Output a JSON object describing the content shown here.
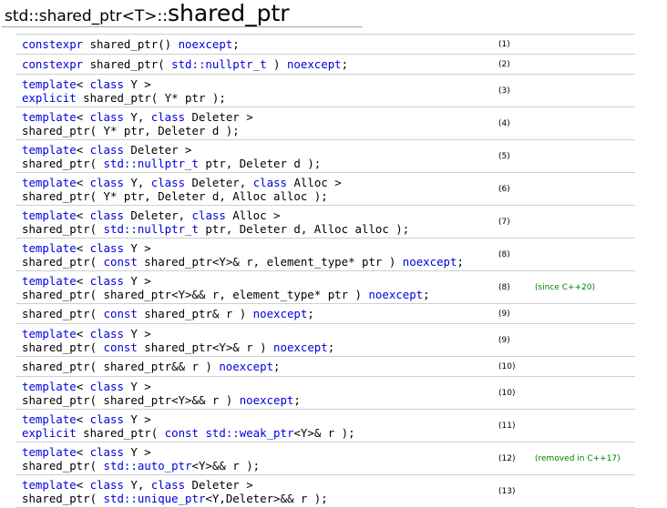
{
  "title": {
    "prefix": "std::shared_ptr<T>::",
    "name": "shared_ptr"
  },
  "rows": [
    {
      "lines": [
        [
          [
            "kw",
            "constexpr"
          ],
          [
            "t",
            " shared_ptr() "
          ],
          [
            "kw",
            "noexcept"
          ],
          [
            "t",
            ";"
          ]
        ]
      ],
      "num": "(1)",
      "note": ""
    },
    {
      "lines": [
        [
          [
            "kw",
            "constexpr"
          ],
          [
            "t",
            " shared_ptr( "
          ],
          [
            "kw",
            "std::nullptr_t"
          ],
          [
            "t",
            " ) "
          ],
          [
            "kw",
            "noexcept"
          ],
          [
            "t",
            ";"
          ]
        ]
      ],
      "num": "(2)",
      "note": ""
    },
    {
      "lines": [
        [
          [
            "kw",
            "template"
          ],
          [
            "t",
            "< "
          ],
          [
            "kw",
            "class"
          ],
          [
            "t",
            " Y >"
          ]
        ],
        [
          [
            "kw",
            "explicit"
          ],
          [
            "t",
            " shared_ptr( Y* ptr );"
          ]
        ]
      ],
      "num": "(3)",
      "note": ""
    },
    {
      "lines": [
        [
          [
            "kw",
            "template"
          ],
          [
            "t",
            "< "
          ],
          [
            "kw",
            "class"
          ],
          [
            "t",
            " Y, "
          ],
          [
            "kw",
            "class"
          ],
          [
            "t",
            " Deleter >"
          ]
        ],
        [
          [
            "t",
            "shared_ptr( Y* ptr, Deleter d );"
          ]
        ]
      ],
      "num": "(4)",
      "note": ""
    },
    {
      "lines": [
        [
          [
            "kw",
            "template"
          ],
          [
            "t",
            "< "
          ],
          [
            "kw",
            "class"
          ],
          [
            "t",
            " Deleter >"
          ]
        ],
        [
          [
            "t",
            "shared_ptr( "
          ],
          [
            "kw",
            "std::nullptr_t"
          ],
          [
            "t",
            " ptr, Deleter d );"
          ]
        ]
      ],
      "num": "(5)",
      "note": ""
    },
    {
      "lines": [
        [
          [
            "kw",
            "template"
          ],
          [
            "t",
            "< "
          ],
          [
            "kw",
            "class"
          ],
          [
            "t",
            " Y, "
          ],
          [
            "kw",
            "class"
          ],
          [
            "t",
            " Deleter, "
          ],
          [
            "kw",
            "class"
          ],
          [
            "t",
            " Alloc >"
          ]
        ],
        [
          [
            "t",
            "shared_ptr( Y* ptr, Deleter d, Alloc alloc );"
          ]
        ]
      ],
      "num": "(6)",
      "note": ""
    },
    {
      "lines": [
        [
          [
            "kw",
            "template"
          ],
          [
            "t",
            "< "
          ],
          [
            "kw",
            "class"
          ],
          [
            "t",
            " Deleter, "
          ],
          [
            "kw",
            "class"
          ],
          [
            "t",
            " Alloc >"
          ]
        ],
        [
          [
            "t",
            "shared_ptr( "
          ],
          [
            "kw",
            "std::nullptr_t"
          ],
          [
            "t",
            " ptr, Deleter d, Alloc alloc );"
          ]
        ]
      ],
      "num": "(7)",
      "note": ""
    },
    {
      "lines": [
        [
          [
            "kw",
            "template"
          ],
          [
            "t",
            "< "
          ],
          [
            "kw",
            "class"
          ],
          [
            "t",
            " Y >"
          ]
        ],
        [
          [
            "t",
            "shared_ptr( "
          ],
          [
            "kw",
            "const"
          ],
          [
            "t",
            " shared_ptr<Y>& r, element_type* ptr ) "
          ],
          [
            "kw",
            "noexcept"
          ],
          [
            "t",
            ";"
          ]
        ]
      ],
      "num": "(8)",
      "note": ""
    },
    {
      "lines": [
        [
          [
            "kw",
            "template"
          ],
          [
            "t",
            "< "
          ],
          [
            "kw",
            "class"
          ],
          [
            "t",
            " Y >"
          ]
        ],
        [
          [
            "t",
            "shared_ptr( shared_ptr<Y>&& r, element_type* ptr ) "
          ],
          [
            "kw",
            "noexcept"
          ],
          [
            "t",
            ";"
          ]
        ]
      ],
      "num": "(8)",
      "note": "(since C++20)"
    },
    {
      "lines": [
        [
          [
            "t",
            "shared_ptr( "
          ],
          [
            "kw",
            "const"
          ],
          [
            "t",
            " shared_ptr& r ) "
          ],
          [
            "kw",
            "noexcept"
          ],
          [
            "t",
            ";"
          ]
        ]
      ],
      "num": "(9)",
      "note": ""
    },
    {
      "lines": [
        [
          [
            "kw",
            "template"
          ],
          [
            "t",
            "< "
          ],
          [
            "kw",
            "class"
          ],
          [
            "t",
            " Y >"
          ]
        ],
        [
          [
            "t",
            "shared_ptr( "
          ],
          [
            "kw",
            "const"
          ],
          [
            "t",
            " shared_ptr<Y>& r ) "
          ],
          [
            "kw",
            "noexcept"
          ],
          [
            "t",
            ";"
          ]
        ]
      ],
      "num": "(9)",
      "note": ""
    },
    {
      "lines": [
        [
          [
            "t",
            "shared_ptr( shared_ptr&& r ) "
          ],
          [
            "kw",
            "noexcept"
          ],
          [
            "t",
            ";"
          ]
        ]
      ],
      "num": "(10)",
      "note": ""
    },
    {
      "lines": [
        [
          [
            "kw",
            "template"
          ],
          [
            "t",
            "< "
          ],
          [
            "kw",
            "class"
          ],
          [
            "t",
            " Y >"
          ]
        ],
        [
          [
            "t",
            "shared_ptr( shared_ptr<Y>&& r ) "
          ],
          [
            "kw",
            "noexcept"
          ],
          [
            "t",
            ";"
          ]
        ]
      ],
      "num": "(10)",
      "note": ""
    },
    {
      "lines": [
        [
          [
            "kw",
            "template"
          ],
          [
            "t",
            "< "
          ],
          [
            "kw",
            "class"
          ],
          [
            "t",
            " Y >"
          ]
        ],
        [
          [
            "kw",
            "explicit"
          ],
          [
            "t",
            " shared_ptr( "
          ],
          [
            "kw",
            "const"
          ],
          [
            "t",
            " "
          ],
          [
            "kw",
            "std::weak_ptr"
          ],
          [
            "t",
            "<Y>& r );"
          ]
        ]
      ],
      "num": "(11)",
      "note": ""
    },
    {
      "lines": [
        [
          [
            "kw",
            "template"
          ],
          [
            "t",
            "< "
          ],
          [
            "kw",
            "class"
          ],
          [
            "t",
            " Y >"
          ]
        ],
        [
          [
            "t",
            "shared_ptr( "
          ],
          [
            "kw",
            "std::auto_ptr"
          ],
          [
            "t",
            "<Y>&& r );"
          ]
        ]
      ],
      "num": "(12)",
      "note": "(removed in C++17)"
    },
    {
      "lines": [
        [
          [
            "kw",
            "template"
          ],
          [
            "t",
            "< "
          ],
          [
            "kw",
            "class"
          ],
          [
            "t",
            " Y, "
          ],
          [
            "kw",
            "class"
          ],
          [
            "t",
            " Deleter >"
          ]
        ],
        [
          [
            "t",
            "shared_ptr( "
          ],
          [
            "kw",
            "std::unique_ptr"
          ],
          [
            "t",
            "<Y,Deleter>&& r );"
          ]
        ]
      ],
      "num": "(13)",
      "note": ""
    }
  ],
  "colors": {
    "keyword": "#0000dd",
    "note": "#008000",
    "rule": "#cfcfcf"
  }
}
